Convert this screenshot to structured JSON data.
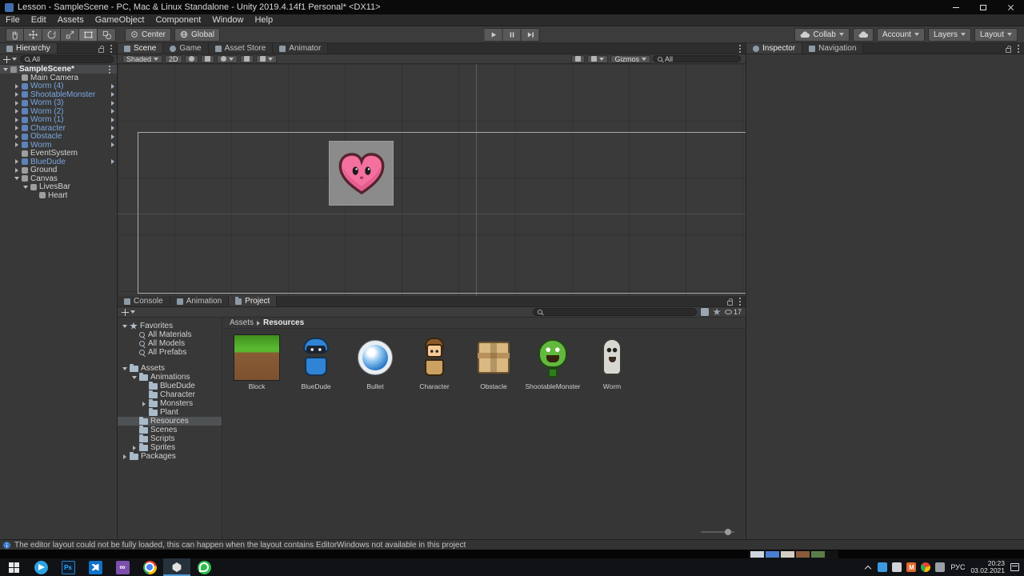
{
  "window": {
    "title": "Lesson - SampleScene - PC, Mac & Linux Standalone - Unity 2019.4.14f1 Personal* <DX11>"
  },
  "menu": {
    "items": [
      {
        "label": "File"
      },
      {
        "label": "Edit"
      },
      {
        "label": "Assets"
      },
      {
        "label": "GameObject"
      },
      {
        "label": "Component"
      },
      {
        "label": "Window"
      },
      {
        "label": "Help"
      }
    ]
  },
  "toolbar": {
    "pivot": "Center",
    "space": "Global",
    "collab": "Collab",
    "account": "Account",
    "layers": "Layers",
    "layout": "Layout"
  },
  "hierarchy": {
    "tab": "Hierarchy",
    "search": "All",
    "scene": "SampleScene*",
    "items": [
      {
        "label": "Main Camera",
        "indent": 1,
        "kind": "normal",
        "tri": "",
        "arrow": false
      },
      {
        "label": "Worm (4)",
        "indent": 1,
        "kind": "prefab",
        "tri": "closed",
        "arrow": true
      },
      {
        "label": "ShootableMonster",
        "indent": 1,
        "kind": "prefab",
        "tri": "closed",
        "arrow": true
      },
      {
        "label": "Worm (3)",
        "indent": 1,
        "kind": "prefab",
        "tri": "closed",
        "arrow": true
      },
      {
        "label": "Worm (2)",
        "indent": 1,
        "kind": "prefab",
        "tri": "closed",
        "arrow": true
      },
      {
        "label": "Worm (1)",
        "indent": 1,
        "kind": "prefab",
        "tri": "closed",
        "arrow": true
      },
      {
        "label": "Character",
        "indent": 1,
        "kind": "prefab",
        "tri": "closed",
        "arrow": true
      },
      {
        "label": "Obstacle",
        "indent": 1,
        "kind": "prefab",
        "tri": "closed",
        "arrow": true
      },
      {
        "label": "Worm",
        "indent": 1,
        "kind": "prefab",
        "tri": "closed",
        "arrow": true
      },
      {
        "label": "EventSystem",
        "indent": 1,
        "kind": "normal",
        "tri": "",
        "arrow": false
      },
      {
        "label": "BlueDude",
        "indent": 1,
        "kind": "prefab",
        "tri": "closed",
        "arrow": true
      },
      {
        "label": "Ground",
        "indent": 1,
        "kind": "normal",
        "tri": "closed",
        "arrow": false
      },
      {
        "label": "Canvas",
        "indent": 1,
        "kind": "normal",
        "tri": "open",
        "arrow": false
      },
      {
        "label": "LivesBar",
        "indent": 2,
        "kind": "normal",
        "tri": "open",
        "arrow": false
      },
      {
        "label": "Heart",
        "indent": 3,
        "kind": "normal",
        "tri": "",
        "arrow": false
      }
    ]
  },
  "scene": {
    "tabs": [
      {
        "label": "Scene",
        "icon": "scene",
        "active": true
      },
      {
        "label": "Game",
        "icon": "game"
      },
      {
        "label": "Asset Store",
        "icon": "store"
      },
      {
        "label": "Animator",
        "icon": "animator"
      }
    ],
    "shading": "Shaded",
    "mode_2d": "2D",
    "gizmos": "Gizmos",
    "search": "All"
  },
  "project": {
    "tabs": [
      {
        "label": "Console",
        "icon": "console"
      },
      {
        "label": "Animation",
        "icon": "animation"
      },
      {
        "label": "Project",
        "icon": "project",
        "active": true
      }
    ],
    "breadcrumb_root": "Assets",
    "breadcrumb_current": "Resources",
    "hidden_count": "17",
    "tree": [
      {
        "label": "Favorites",
        "indent": 0,
        "icon": "star",
        "tri": "open"
      },
      {
        "label": "All Materials",
        "indent": 1,
        "icon": "search",
        "tri": ""
      },
      {
        "label": "All Models",
        "indent": 1,
        "icon": "search",
        "tri": ""
      },
      {
        "label": "All Prefabs",
        "indent": 1,
        "icon": "search",
        "tri": ""
      },
      {
        "label": "Assets",
        "indent": 0,
        "icon": "folder",
        "tri": "open",
        "gap": true
      },
      {
        "label": "Animations",
        "indent": 1,
        "icon": "folder",
        "tri": "open"
      },
      {
        "label": "BlueDude",
        "indent": 2,
        "icon": "folder",
        "tri": ""
      },
      {
        "label": "Character",
        "indent": 2,
        "icon": "folder",
        "tri": ""
      },
      {
        "label": "Monsters",
        "indent": 2,
        "icon": "folder",
        "tri": "closed"
      },
      {
        "label": "Plant",
        "indent": 2,
        "icon": "folder",
        "tri": ""
      },
      {
        "label": "Resources",
        "indent": 1,
        "icon": "folder",
        "tri": "",
        "selected": true
      },
      {
        "label": "Scenes",
        "indent": 1,
        "icon": "folder",
        "tri": ""
      },
      {
        "label": "Scripts",
        "indent": 1,
        "icon": "folder",
        "tri": ""
      },
      {
        "label": "Sprites",
        "indent": 1,
        "icon": "folder",
        "tri": "closed"
      },
      {
        "label": "Packages",
        "indent": 0,
        "icon": "folder",
        "tri": "closed"
      }
    ],
    "assets": [
      {
        "label": "Block",
        "kind": "block"
      },
      {
        "label": "BlueDude",
        "kind": "bluedude"
      },
      {
        "label": "Bullet",
        "kind": "bullet"
      },
      {
        "label": "Character",
        "kind": "character"
      },
      {
        "label": "Obstacle",
        "kind": "obstacle"
      },
      {
        "label": "ShootableMonster",
        "kind": "monster"
      },
      {
        "label": "Worm",
        "kind": "worm"
      }
    ]
  },
  "inspector": {
    "tabs": [
      {
        "label": "Inspector",
        "icon": "inspector",
        "active": true
      },
      {
        "label": "Navigation",
        "icon": "navigation"
      }
    ]
  },
  "status": {
    "message": "The editor layout could not be fully loaded, this can happen when the layout contains EditorWindows not available in this project"
  },
  "taskbar": {
    "apps": [
      {
        "name": "telegram"
      },
      {
        "name": "photoshop",
        "glyph": "Ps"
      },
      {
        "name": "vscode"
      },
      {
        "name": "visual-studio",
        "glyph": "∞"
      },
      {
        "name": "chrome"
      },
      {
        "name": "unity",
        "active": true
      },
      {
        "name": "whatsapp"
      }
    ],
    "tray": [
      {
        "name": "hidden-icons"
      },
      {
        "name": "tray-blue"
      },
      {
        "name": "tray-light"
      },
      {
        "name": "tray-orange",
        "glyph": "M"
      },
      {
        "name": "tray-chrome"
      },
      {
        "name": "tray-gray"
      }
    ],
    "lang": "РУС",
    "time": "20:23",
    "date": "03.02.2021"
  },
  "colors": {
    "prefab_text": "#7aa7e0",
    "selection": "#4f5255",
    "heart_pink": "#f4709f"
  }
}
